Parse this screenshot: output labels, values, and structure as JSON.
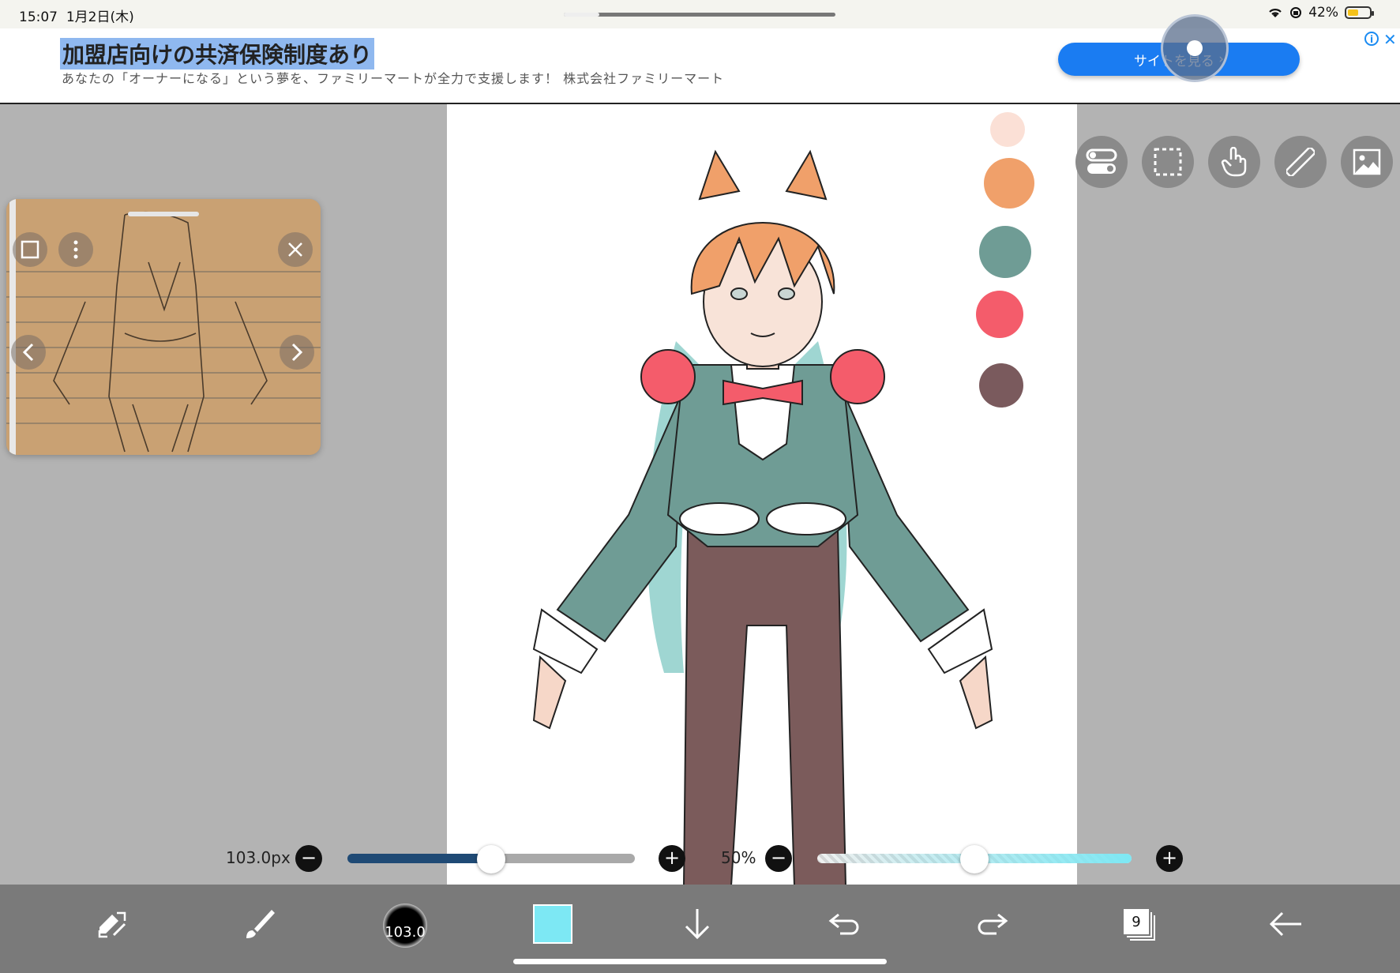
{
  "status_bar": {
    "time": "15:07",
    "date": "1月2日(木)",
    "battery": "42%",
    "battery_level": 0.42
  },
  "ad": {
    "title": "加盟店向けの共済保険制度あり",
    "description": "あなたの「オーナーになる」という夢を、ファミリーマートが全力で支援します！ 株式会社ファミリーマート",
    "cta": "サイトを見る",
    "info_icon": "info-icon",
    "close_icon": "close-icon"
  },
  "palette": {
    "colors": [
      "#fbe0d6",
      "#f0a06a",
      "#6f9c95",
      "#f45c6b",
      "#7a5a5d"
    ]
  },
  "tools_right": [
    "toggle-switch-icon",
    "selection-icon",
    "hand-touch-icon",
    "ruler-icon",
    "image-icon"
  ],
  "brush_size": {
    "label": "103.0px",
    "value": 103.0,
    "fraction": 0.5
  },
  "opacity": {
    "label": "50%",
    "fraction": 0.5
  },
  "bottom_bar": {
    "brush_preview_value": "103.0",
    "layer_count": "9",
    "icons": [
      "swap-tool-icon",
      "brush-icon",
      "brush-size-icon",
      "color-swatch-icon",
      "download-icon",
      "undo-icon",
      "redo-icon",
      "layers-icon",
      "back-arrow-icon"
    ]
  },
  "colors": {
    "accent_blue": "#1a7cf2",
    "size_track": "#1f4a75",
    "opacity_track": "#7de8f4"
  }
}
